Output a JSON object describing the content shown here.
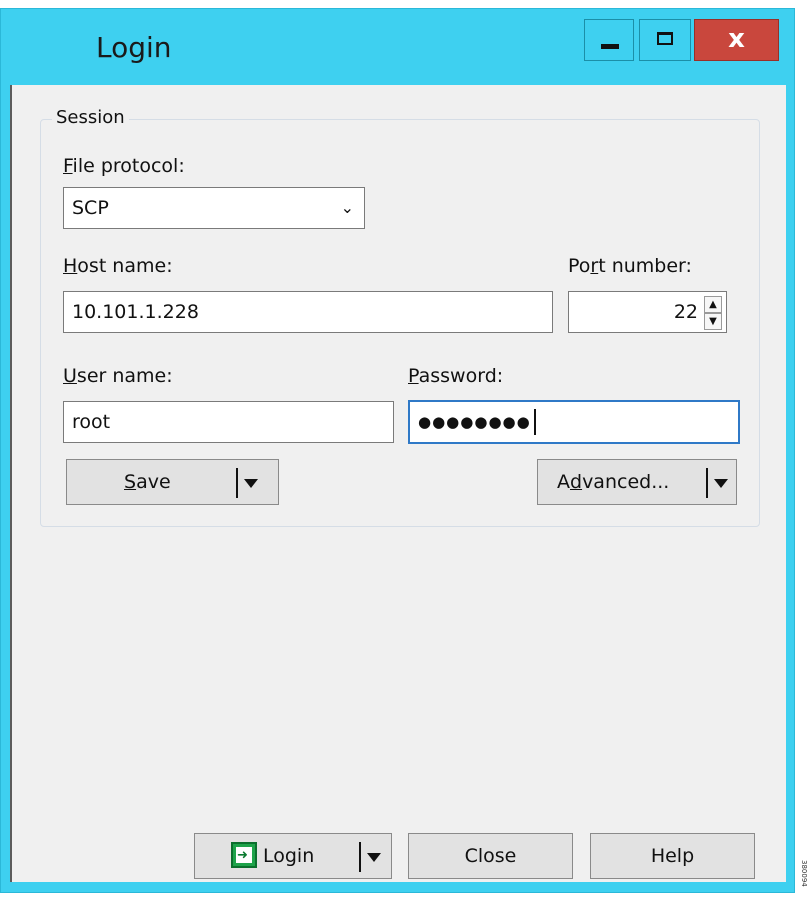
{
  "window": {
    "title": "Login",
    "close_glyph": "x"
  },
  "session": {
    "legend": "Session",
    "file_protocol": {
      "label_first": "F",
      "label_rest": "ile protocol:",
      "value": "SCP"
    },
    "host_name": {
      "label_first": "H",
      "label_rest": "ost name:",
      "value": "10.101.1.228"
    },
    "port_number": {
      "label_pre": "Po",
      "label_u": "r",
      "label_post": "t number:",
      "value": "22"
    },
    "user_name": {
      "label_first": "U",
      "label_rest": "ser name:",
      "value": "root"
    },
    "password": {
      "label_first": "P",
      "label_rest": "assword:",
      "masked_value": "●●●●●●●●"
    },
    "save_button": {
      "label_first": "S",
      "label_rest": "ave"
    },
    "advanced_button": {
      "label_pre": "A",
      "label_u": "d",
      "label_post": "vanced..."
    }
  },
  "footer": {
    "login_label": "Login",
    "close_label": "Close",
    "help_label": "Help"
  },
  "icons": {
    "minimize": "minimize-icon",
    "maximize": "maximize-icon",
    "close": "close-icon",
    "dropdown": "chevron-down-icon",
    "login": "login-icon"
  },
  "colors": {
    "titlebar": "#3ed0f0",
    "close_button": "#c9473d",
    "client_bg": "#f0f0f0",
    "focus_border": "#2f79c7",
    "login_icon": "#1ea34a"
  },
  "watermark": "380094"
}
